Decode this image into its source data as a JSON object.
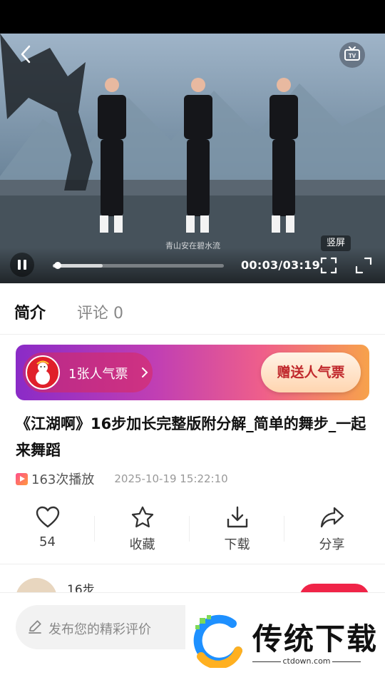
{
  "player": {
    "watermark": "青山安在碧水流",
    "portrait_label": "竖屏",
    "time": "00:03/03:19",
    "progress_fraction": 0.015,
    "buffered_fraction": 0.29
  },
  "tabs": {
    "intro": "简介",
    "comments": "评论 0"
  },
  "banner": {
    "tickets": "1张人气票",
    "gift": "赠送人气票"
  },
  "video": {
    "title": "《江湖啊》16步加长完整版附分解_简单的舞步_一起来舞蹈",
    "plays": "163次播放",
    "date": "2025-10-19 15:22:10"
  },
  "actions": {
    "like_count": "54",
    "favorite": "收藏",
    "download": "下载",
    "share": "分享"
  },
  "author": {
    "name": "16步"
  },
  "comment": {
    "placeholder": "发布您的精彩评价"
  },
  "logo": {
    "brand": "传统下载",
    "domain": "ctdown.com"
  },
  "colors": {
    "accent_pink": "#ff4d8d",
    "accent_purple": "#8a2be2",
    "accent_orange": "#ff9a3c",
    "follow_red": "#f02448"
  }
}
